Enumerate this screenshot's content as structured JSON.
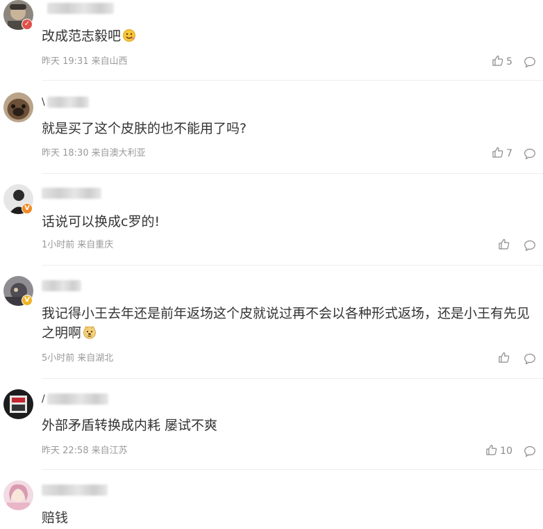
{
  "comments": [
    {
      "username_first": "",
      "text": "改成范志毅吧",
      "date": "昨天 19:31",
      "location": "来自山西",
      "likes": "5",
      "emoji": "smile-emoji",
      "badge": "red-verified-badge",
      "avatar_color": "#6e6a63"
    },
    {
      "username_first": "\\",
      "text": "就是买了这个皮肤的也不能用了吗?",
      "date": "昨天 18:30",
      "location": "来自澳大利亚",
      "likes": "7",
      "badge": "",
      "avatar_color": "#7a6248"
    },
    {
      "username_first": "",
      "text": "话说可以换成c罗的!",
      "date": "1小时前",
      "location": "来自重庆",
      "likes": "",
      "badge": "orange-verified-badge",
      "avatar_color": "#d9d9d9"
    },
    {
      "username_first": "",
      "text": "我记得小王去年还是前年返场这个皮就说过再不会以各种形式返场，还是小王有先见之明啊",
      "date": "5小时前",
      "location": "来自湖北",
      "likes": "",
      "emoji": "doge-emoji",
      "badge": "gold-verified-badge",
      "avatar_color": "#5b5a5e"
    },
    {
      "username_first": "/",
      "text": "外部矛盾转换成内耗 屡试不爽",
      "date": "昨天 22:58",
      "location": "来自江苏",
      "likes": "10",
      "badge": "",
      "avatar_color": "#1c1c1c"
    },
    {
      "username_first": "",
      "text": "赔钱",
      "date": "",
      "location": "",
      "likes": "",
      "badge": "",
      "avatar_color": "#e9c8d2"
    }
  ],
  "icons": {
    "like": "thumbs-up-icon",
    "reply": "comment-bubble-icon"
  }
}
